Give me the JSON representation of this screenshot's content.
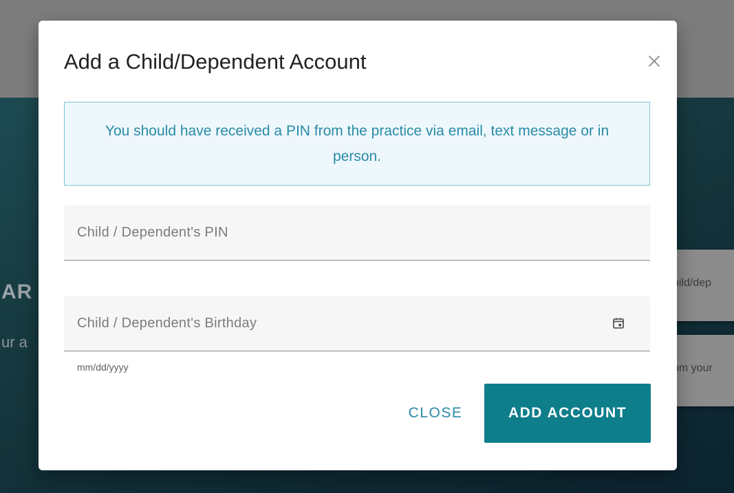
{
  "background": {
    "hero_title": "AR",
    "hero_subtitle": "ur a",
    "cards": [
      {
        "text": "hild/dep"
      },
      {
        "text": "om your"
      }
    ]
  },
  "modal": {
    "title": "Add a Child/Dependent Account",
    "close_icon": "close-icon",
    "info_message": "You should have received a PIN from the practice via email, text message or in person.",
    "fields": {
      "pin": {
        "placeholder": "Child / Dependent's PIN",
        "value": ""
      },
      "birthday": {
        "placeholder": "Child / Dependent's Birthday",
        "value": "",
        "hint": "mm/dd/yyyy",
        "icon": "calendar-icon"
      }
    },
    "buttons": {
      "close_label": "CLOSE",
      "add_label": "ADD ACCOUNT"
    }
  },
  "colors": {
    "accent": "#0e7e8b",
    "info_text": "#2a8aa6",
    "info_border": "#7dc3d6",
    "info_bg": "#eef8fc"
  }
}
